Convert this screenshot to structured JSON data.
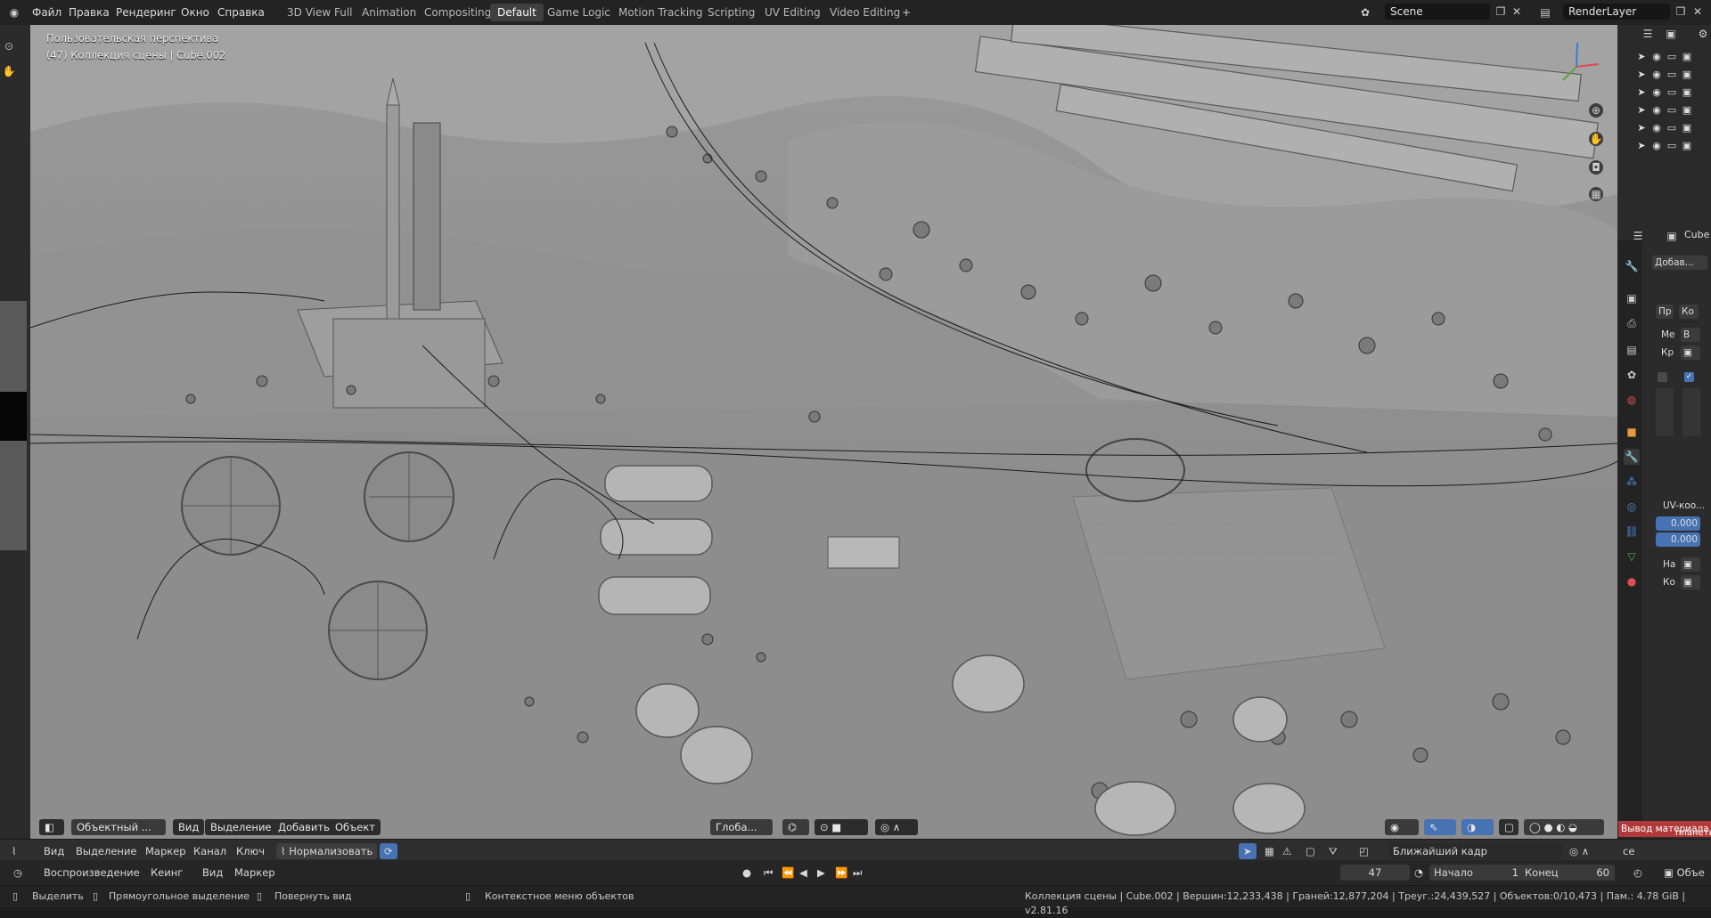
{
  "menu": [
    "Файл",
    "Правка",
    "Рендеринг",
    "Окно",
    "Справка"
  ],
  "workspaces": [
    {
      "label": "3D View Full",
      "active": false
    },
    {
      "label": "Animation",
      "active": false
    },
    {
      "label": "Compositing",
      "active": false
    },
    {
      "label": "Default",
      "active": true
    },
    {
      "label": "Game Logic",
      "active": false
    },
    {
      "label": "Motion Tracking",
      "active": false
    },
    {
      "label": "Scripting",
      "active": false
    },
    {
      "label": "UV Editing",
      "active": false
    },
    {
      "label": "Video Editing",
      "active": false
    }
  ],
  "add_workspace_icon": "plus-icon",
  "scene": {
    "name": "Scene"
  },
  "view_layer": {
    "name": "RenderLayer"
  },
  "viewport": {
    "perspective_label": "Пользовательская перспектива",
    "collection_label": "(47) Коллекция сцены | Cube.002",
    "header": {
      "mode": "Объектный ...",
      "menu": [
        "Вид",
        "Выделение",
        "Добавить",
        "Объект"
      ],
      "orientation": "Глоба..."
    }
  },
  "properties": {
    "object_name": "Cube",
    "add_label": "Добав...",
    "tab_pr": "Пр",
    "tab_ko": "Ко",
    "me_label": "Ме",
    "v_label": "В",
    "kr_label": "Кр",
    "uv_label": "UV-коо...",
    "uv_x": "0.000",
    "uv_y": "0.000",
    "na_label": "На",
    "ko2_label": "Ко",
    "material_output": "Вывод материала",
    "planet": "планеты"
  },
  "timeline_header": {
    "menu": [
      "Вид",
      "Выделение",
      "Маркер",
      "Канал",
      "Ключ"
    ],
    "normalize": "Нормализовать",
    "nearest_frame": "Ближайший кадр",
    "ce_label": "ce"
  },
  "playback": {
    "playback_menu": "Воспроизведение",
    "keying_menu": "Кеинг",
    "view_menu": "Вид",
    "marker_menu": "Маркер",
    "current_frame": "47",
    "start_label": "Начало",
    "start_value": "1",
    "end_label": "Конец",
    "end_value": "60",
    "obj_label": "Объе"
  },
  "statusbar": {
    "select": "Выделить",
    "box_select": "Прямоугольное выделение",
    "rotate_view": "Повернуть вид",
    "context_menu": "Контекстное меню объектов",
    "stats": "Коллекция сцены | Cube.002 | Вершин:12,233,438 | Граней:12,877,204 | Треуг.:24,439,527 | Объектов:0/10,473 | Пам.: 4.78 GiB | v2.81.16"
  }
}
